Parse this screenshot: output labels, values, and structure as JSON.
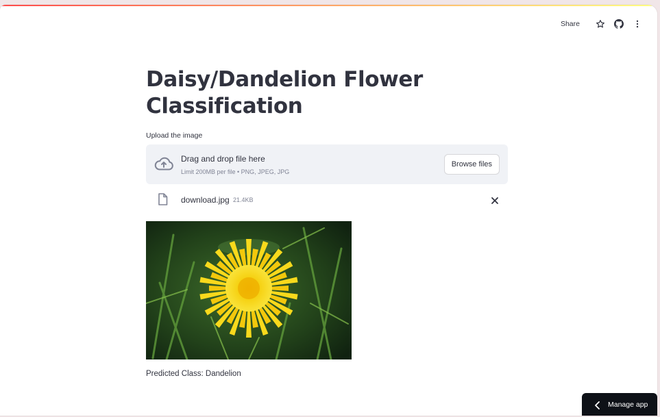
{
  "header": {
    "share_label": "Share",
    "icons": [
      "star-icon",
      "github-icon",
      "more-vertical-icon"
    ]
  },
  "main": {
    "title": "Daisy/Dandelion Flower Classification",
    "uploader": {
      "label": "Upload the image",
      "drag_text": "Drag and drop file here",
      "limit_text": "Limit 200MB per file • PNG, JPEG, JPG",
      "browse_label": "Browse files"
    },
    "file": {
      "name": "download.jpg",
      "size": "21.4KB"
    },
    "prediction": "Predicted Class: Dandelion"
  },
  "footer": {
    "manage_app_label": "Manage app"
  },
  "colors": {
    "text": "#31333f",
    "muted": "#808495",
    "dropzone_bg": "#f0f2f6",
    "manage_bg": "#0e1117",
    "flower": "#f5d60f"
  }
}
